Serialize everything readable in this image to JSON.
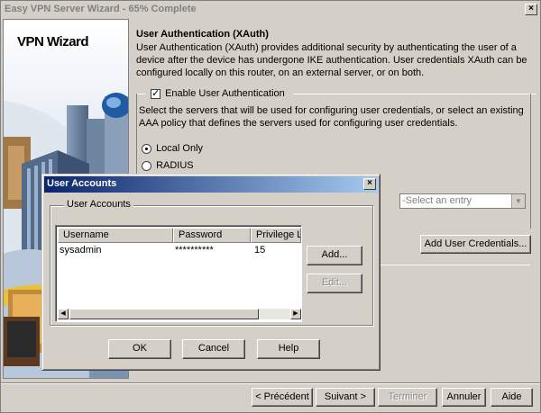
{
  "window": {
    "title": "Easy VPN Server Wizard - 65% Complete",
    "close": "×"
  },
  "sidebar": {
    "title": "VPN Wizard"
  },
  "main": {
    "heading": "User Authentication (XAuth)",
    "description": "User Authentication (XAuth) provides additional security by authenticating the user of a device after the device has undergone IKE authentication. User credentials XAuth can be configured locally on this router, on an external server, or on both.",
    "enable_label": "Enable User Authentication",
    "enable_checked": true,
    "servers_text": "Select the servers that will be used for configuring user credentials, or select an existing AAA policy that defines the servers used for configuring user credentials.",
    "option_local": "Local Only",
    "option_radius": "RADIUS",
    "selected_option": "local",
    "select_entry_placeholder": "-Select an entry",
    "add_credentials_label": "Add User Credentials..."
  },
  "footer": {
    "previous": "< Précédent",
    "next": "Suivant >",
    "finish": "Terminer",
    "cancel": "Annuler",
    "help": "Aide"
  },
  "dialog": {
    "title": "User Accounts",
    "close": "×",
    "group_label": "User Accounts",
    "columns": [
      "Username",
      "Password",
      "Privilege L"
    ],
    "rows": [
      {
        "username": "sysadmin",
        "password": "**********",
        "privilege": "15"
      }
    ],
    "add_label": "Add...",
    "edit_label": "Edit...",
    "ok_label": "OK",
    "cancel_label": "Cancel",
    "help_label": "Help"
  }
}
